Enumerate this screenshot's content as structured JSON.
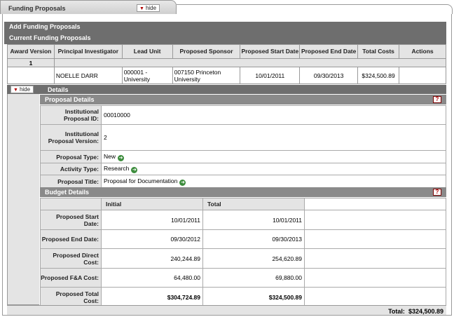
{
  "tab": {
    "title": "Funding Proposals",
    "hide_label": "hide"
  },
  "add_header": "Add Funding Proposals",
  "current_header": "Current Funding Proposals",
  "grid": {
    "headers": [
      "Award Version",
      "Principal Investigator",
      "Lead Unit",
      "Proposed Sponsor",
      "Proposed Start Date",
      "Proposed End Date",
      "Total Costs",
      "Actions"
    ],
    "version_row": "1",
    "row": {
      "pi": "NOELLE DARR",
      "lead_unit": "000001  -  University",
      "sponsor": "007150   Princeton University",
      "start": "10/01/2011",
      "end": "09/30/2013",
      "total": "$324,500.89",
      "actions": ""
    }
  },
  "details": {
    "hide_label": "hide",
    "label": "Details"
  },
  "proposal_details": {
    "header": "Proposal Details",
    "help": "?",
    "rows": [
      {
        "label": "Institutional Proposal ID:",
        "value": "00010000"
      },
      {
        "label": "Institutional Proposal Version:",
        "value": "2"
      },
      {
        "label": "Proposal Type:",
        "value": "New"
      },
      {
        "label": "Activity Type:",
        "value": "Research"
      },
      {
        "label": "Proposal Title:",
        "value": "Proposal for Documentation"
      }
    ]
  },
  "budget_details": {
    "header": "Budget Details",
    "help": "?",
    "col_initial": "Initial",
    "col_total": "Total",
    "rows": [
      {
        "label": "Proposed Start Date:",
        "initial": "10/01/2011",
        "total": "10/01/2011"
      },
      {
        "label": "Proposed End Date:",
        "initial": "09/30/2012",
        "total": "09/30/2013"
      },
      {
        "label": "Proposed Direct Cost:",
        "initial": "240,244.89",
        "total": "254,620.89"
      },
      {
        "label": "Proposed F&A Cost:",
        "initial": "64,480.00",
        "total": "69,880.00"
      },
      {
        "label": "Proposed Total Cost:",
        "initial": "$304,724.89",
        "total": "$324,500.89"
      }
    ]
  },
  "total": {
    "label": "Total:",
    "value": "$324,500.89"
  },
  "colors": {
    "bar_dark": "#6e6e6e",
    "bar_mid": "#8a8a8a",
    "label_bg": "#e4e4e4",
    "hide_arrow": "#b00000"
  }
}
